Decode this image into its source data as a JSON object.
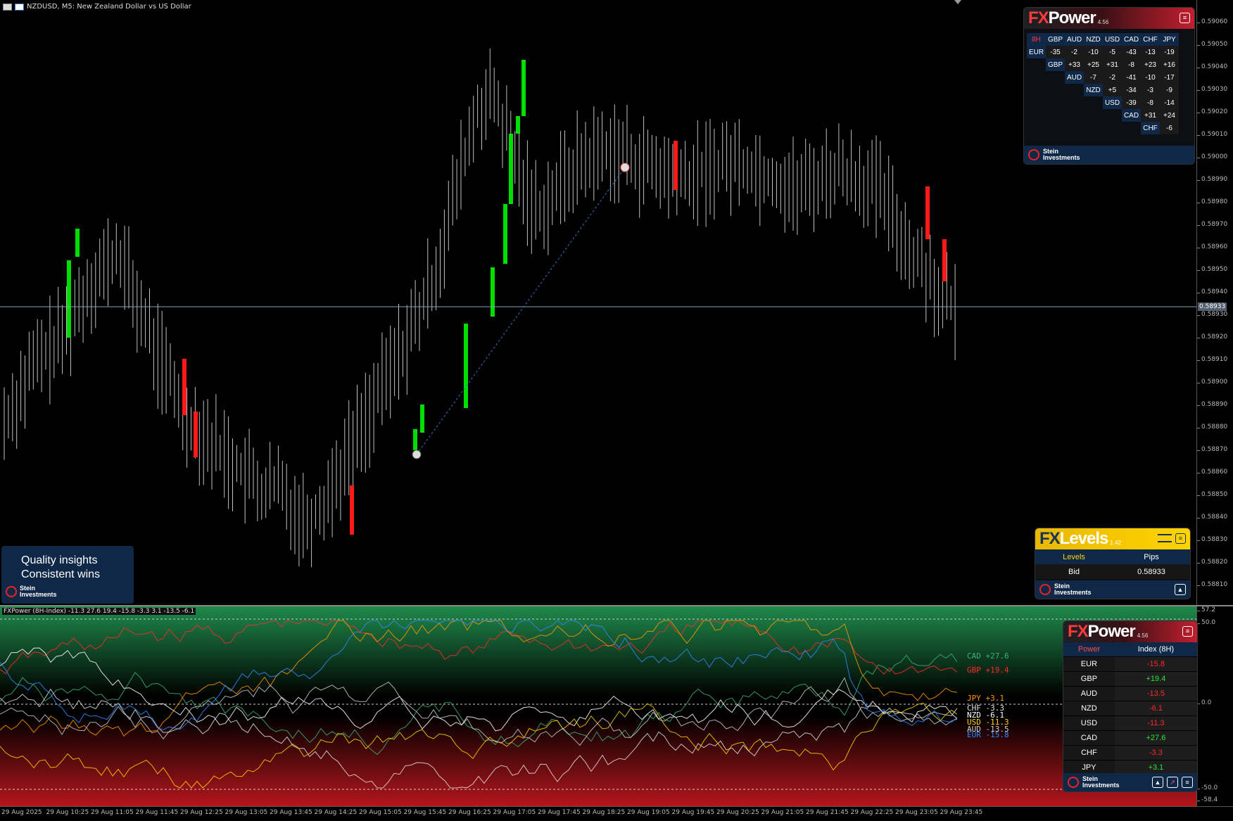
{
  "symbol_bar": {
    "text": "NZDUSD, M5:  New Zealand Dollar vs US Dollar"
  },
  "price_axis": [
    "0.59060",
    "0.59050",
    "0.59040",
    "0.59030",
    "0.59020",
    "0.59010",
    "0.59000",
    "0.58990",
    "0.58980",
    "0.58970",
    "0.58960",
    "0.58950",
    "0.58940",
    "0.58930",
    "0.58920",
    "0.58910",
    "0.58900",
    "0.58890",
    "0.58880",
    "0.58870",
    "0.58860",
    "0.58850",
    "0.58840",
    "0.58830",
    "0.58820",
    "0.58810"
  ],
  "bid_tag": "0.58933",
  "indicator_label": "FXPower (8H-Index) -11.3 27.6 19.4 -15.8 -3.3 3.1 -13.5 -6.1",
  "indicator_axis": {
    "top": "57.2",
    "upper": "50.0",
    "zero": "0.0",
    "lower": "-50.0",
    "bottom": "-58.4"
  },
  "time_axis": [
    "29 Aug 2025",
    "29 Aug 10:25",
    "29 Aug 11:05",
    "29 Aug 11:45",
    "29 Aug 12:25",
    "29 Aug 13:05",
    "29 Aug 13:45",
    "29 Aug 14:25",
    "29 Aug 15:05",
    "29 Aug 15:45",
    "29 Aug 16:25",
    "29 Aug 17:05",
    "29 Aug 17:45",
    "29 Aug 18:25",
    "29 Aug 19:05",
    "29 Aug 19:45",
    "29 Aug 20:25",
    "29 Aug 21:05",
    "29 Aug 21:45",
    "29 Aug 22:25",
    "29 Aug 23:05",
    "29 Aug 23:45"
  ],
  "fxpower_matrix": {
    "logo_fx": "FX",
    "logo_power": "Power",
    "version": "4.56",
    "period": "8H",
    "columns": [
      "GBP",
      "AUD",
      "NZD",
      "USD",
      "CAD",
      "CHF",
      "JPY"
    ],
    "rows": [
      {
        "label": "EUR",
        "values": [
          "-35",
          "-2",
          "-10",
          "-5",
          "-43",
          "-13",
          "-19"
        ]
      },
      {
        "label": "GBP",
        "values": [
          "+33",
          "+25",
          "+31",
          "-8",
          "+23",
          "+16"
        ]
      },
      {
        "label": "AUD",
        "values": [
          "-7",
          "-2",
          "-41",
          "-10",
          "-17"
        ]
      },
      {
        "label": "NZD",
        "values": [
          "+5",
          "-34",
          "-3",
          "-9"
        ]
      },
      {
        "label": "USD",
        "values": [
          "-39",
          "-8",
          "-14"
        ]
      },
      {
        "label": "CAD",
        "values": [
          "+31",
          "+24"
        ]
      },
      {
        "label": "CHF",
        "values": [
          "-6"
        ]
      }
    ],
    "brand_line1": "Stein",
    "brand_line2": "Investments"
  },
  "fxlevels": {
    "logo_fx": "FX",
    "logo_levels": "Levels",
    "version": "1.42",
    "col1": "Levels",
    "col2": "Pips",
    "row_label": "Bid",
    "row_value": "0.58933",
    "brand_line1": "Stein",
    "brand_line2": "Investments"
  },
  "quality": {
    "line1": "Quality insights",
    "line2": "Consistent wins",
    "brand_line1": "Stein",
    "brand_line2": "Investments"
  },
  "fxpower_index": {
    "logo_fx": "FX",
    "logo_power": "Power",
    "version": "4.56",
    "col1": "Power",
    "col2": "Index (8H)",
    "rows": [
      {
        "label": "EUR",
        "value": "-15.8"
      },
      {
        "label": "GBP",
        "value": "+19.4"
      },
      {
        "label": "AUD",
        "value": "-13.5"
      },
      {
        "label": "NZD",
        "value": "-6.1"
      },
      {
        "label": "USD",
        "value": "-11.3"
      },
      {
        "label": "CAD",
        "value": "+27.6"
      },
      {
        "label": "CHF",
        "value": "-3.3"
      },
      {
        "label": "JPY",
        "value": "+3.1"
      }
    ],
    "brand_line1": "Stein",
    "brand_line2": "Investments"
  },
  "curve_labels": [
    {
      "text": "CAD +27.6",
      "color": "#3cb371"
    },
    {
      "text": "GBP +19.4",
      "color": "#ff2a2a"
    },
    {
      "text": "JPY  +3.1",
      "color": "#ff9800"
    },
    {
      "text": "CHF  -3.3",
      "color": "#e0e0e0"
    },
    {
      "text": "NZD  -6.1",
      "color": "#ffffff"
    },
    {
      "text": "USD -11.3",
      "color": "#ffd400"
    },
    {
      "text": "AUD -13.5",
      "color": "#cccccc"
    },
    {
      "text": "EUR -15.8",
      "color": "#2f8cff"
    }
  ],
  "colors": {
    "bull": "#00e000",
    "bear": "#ff1a1a",
    "neutral_candle": "#bfbfbf",
    "panel_blue": "#0f2847",
    "levels_yellow": "#ffd400"
  }
}
